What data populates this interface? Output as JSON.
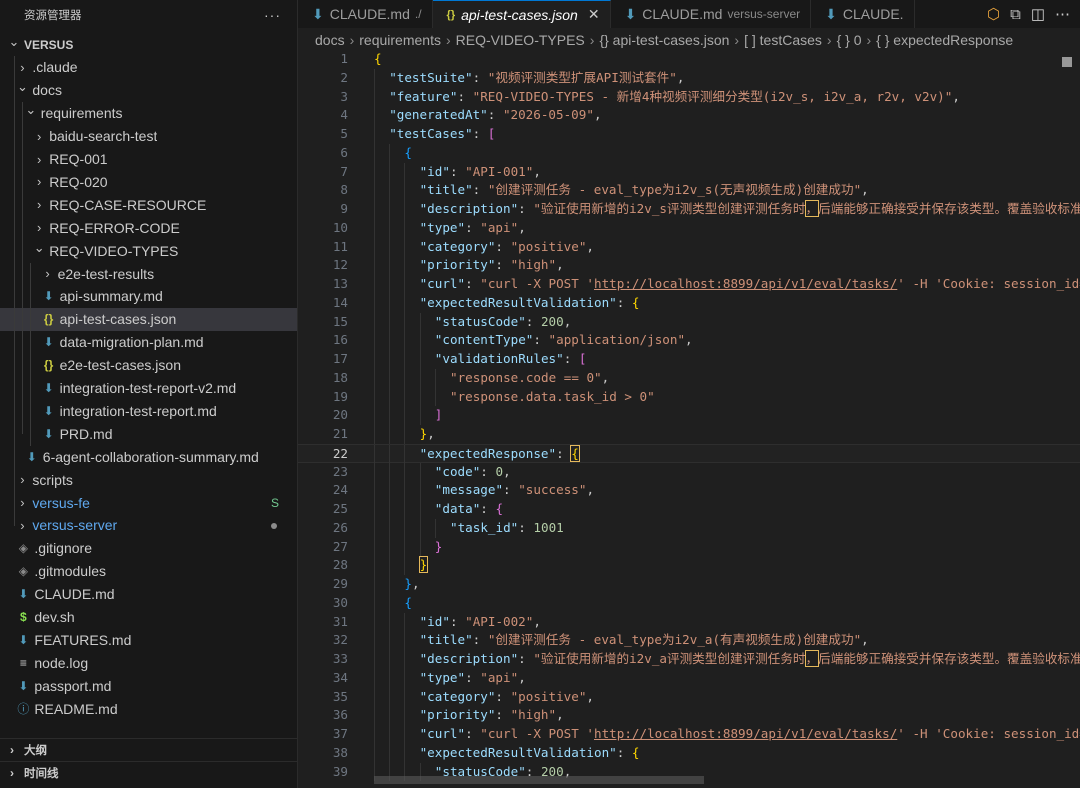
{
  "sidebar": {
    "title": "资源管理器",
    "more": "···",
    "tree": [
      {
        "label": "VERSUS",
        "depth": 0,
        "type": "root",
        "open": true
      },
      {
        "label": ".claude",
        "depth": 1,
        "type": "folder",
        "open": false
      },
      {
        "label": "docs",
        "depth": 1,
        "type": "folder",
        "open": true
      },
      {
        "label": "requirements",
        "depth": 2,
        "type": "folder",
        "open": true
      },
      {
        "label": "baidu-search-test",
        "depth": 3,
        "type": "folder",
        "open": false
      },
      {
        "label": "REQ-001",
        "depth": 3,
        "type": "folder",
        "open": false
      },
      {
        "label": "REQ-020",
        "depth": 3,
        "type": "folder",
        "open": false
      },
      {
        "label": "REQ-CASE-RESOURCE",
        "depth": 3,
        "type": "folder",
        "open": false
      },
      {
        "label": "REQ-ERROR-CODE",
        "depth": 3,
        "type": "folder",
        "open": false
      },
      {
        "label": "REQ-VIDEO-TYPES",
        "depth": 3,
        "type": "folder",
        "open": true
      },
      {
        "label": "e2e-test-results",
        "depth": 4,
        "type": "folder",
        "open": false
      },
      {
        "label": "api-summary.md",
        "depth": 4,
        "type": "md"
      },
      {
        "label": "api-test-cases.json",
        "depth": 4,
        "type": "json",
        "selected": true
      },
      {
        "label": "data-migration-plan.md",
        "depth": 4,
        "type": "md"
      },
      {
        "label": "e2e-test-cases.json",
        "depth": 4,
        "type": "json"
      },
      {
        "label": "integration-test-report-v2.md",
        "depth": 4,
        "type": "md"
      },
      {
        "label": "integration-test-report.md",
        "depth": 4,
        "type": "md"
      },
      {
        "label": "PRD.md",
        "depth": 4,
        "type": "md"
      },
      {
        "label": "6-agent-collaboration-summary.md",
        "depth": 2,
        "type": "md"
      },
      {
        "label": "scripts",
        "depth": 1,
        "type": "folder",
        "open": false
      },
      {
        "label": "versus-fe",
        "depth": 1,
        "type": "folder",
        "open": false,
        "color": "#5fa8ee",
        "badge": "S"
      },
      {
        "label": "versus-server",
        "depth": 1,
        "type": "folder",
        "open": false,
        "color": "#5fa8ee",
        "dot": true
      },
      {
        "label": ".gitignore",
        "depth": 1,
        "type": "git"
      },
      {
        "label": ".gitmodules",
        "depth": 1,
        "type": "git"
      },
      {
        "label": "CLAUDE.md",
        "depth": 1,
        "type": "md"
      },
      {
        "label": "dev.sh",
        "depth": 1,
        "type": "sh"
      },
      {
        "label": "FEATURES.md",
        "depth": 1,
        "type": "md"
      },
      {
        "label": "node.log",
        "depth": 1,
        "type": "log"
      },
      {
        "label": "passport.md",
        "depth": 1,
        "type": "md"
      },
      {
        "label": "README.md",
        "depth": 1,
        "type": "info"
      }
    ],
    "sections": [
      "大纲",
      "时间线"
    ]
  },
  "tabs": [
    {
      "label": "CLAUDE.md",
      "desc": "./",
      "icon": "md",
      "active": false
    },
    {
      "label": "api-test-cases.json",
      "desc": "",
      "icon": "json",
      "active": true,
      "close": "✕"
    },
    {
      "label": "CLAUDE.md",
      "desc": "versus-server",
      "icon": "md",
      "active": false
    },
    {
      "label": "CLAUDE.",
      "desc": "",
      "icon": "md",
      "active": false
    }
  ],
  "breadcrumb": [
    "docs",
    "requirements",
    "REQ-VIDEO-TYPES",
    "{} api-test-cases.json",
    "[ ] testCases",
    "{ } 0",
    "{ } expectedResponse"
  ],
  "breadcrumb_sep": "›",
  "editor": {
    "current_line": 22,
    "lines": [
      {
        "n": "1",
        "i": 0,
        "t": [
          [
            "b1",
            "{"
          ]
        ]
      },
      {
        "n": "2",
        "i": 1,
        "t": [
          [
            "k",
            "\"testSuite\""
          ],
          [
            "p",
            ": "
          ],
          [
            "s",
            "\"视频评测类型扩展API测试套件\""
          ],
          [
            "p",
            ","
          ]
        ]
      },
      {
        "n": "3",
        "i": 1,
        "t": [
          [
            "k",
            "\"feature\""
          ],
          [
            "p",
            ": "
          ],
          [
            "s",
            "\"REQ-VIDEO-TYPES - 新增4种视频评测细分类型(i2v_s, i2v_a, r2v, v2v)\""
          ],
          [
            "p",
            ","
          ]
        ]
      },
      {
        "n": "4",
        "i": 1,
        "t": [
          [
            "k",
            "\"generatedAt\""
          ],
          [
            "p",
            ": "
          ],
          [
            "s",
            "\"2026-05-09\""
          ],
          [
            "p",
            ","
          ]
        ]
      },
      {
        "n": "5",
        "i": 1,
        "t": [
          [
            "k",
            "\"testCases\""
          ],
          [
            "p",
            ": "
          ],
          [
            "b2",
            "["
          ]
        ]
      },
      {
        "n": "6",
        "i": 2,
        "t": [
          [
            "b3",
            "{"
          ]
        ]
      },
      {
        "n": "7",
        "i": 3,
        "t": [
          [
            "k",
            "\"id\""
          ],
          [
            "p",
            ": "
          ],
          [
            "s",
            "\"API-001\""
          ],
          [
            "p",
            ","
          ]
        ]
      },
      {
        "n": "8",
        "i": 3,
        "t": [
          [
            "k",
            "\"title\""
          ],
          [
            "p",
            ": "
          ],
          [
            "s",
            "\"创建评测任务 - eval_type为i2v_s(无声视频生成)创建成功\""
          ],
          [
            "p",
            ","
          ]
        ]
      },
      {
        "n": "9",
        "i": 3,
        "t": [
          [
            "k",
            "\"description\""
          ],
          [
            "p",
            ": "
          ],
          [
            "s",
            "\"验证使用新增的i2v_s评测类型创建评测任务时"
          ],
          [
            "smh",
            "，"
          ],
          [
            "s",
            "后端能够正确接受并保存该类型。覆盖验收标准"
          ]
        ]
      },
      {
        "n": "10",
        "i": 3,
        "t": [
          [
            "k",
            "\"type\""
          ],
          [
            "p",
            ": "
          ],
          [
            "s",
            "\"api\""
          ],
          [
            "p",
            ","
          ]
        ]
      },
      {
        "n": "11",
        "i": 3,
        "t": [
          [
            "k",
            "\"category\""
          ],
          [
            "p",
            ": "
          ],
          [
            "s",
            "\"positive\""
          ],
          [
            "p",
            ","
          ]
        ]
      },
      {
        "n": "12",
        "i": 3,
        "t": [
          [
            "k",
            "\"priority\""
          ],
          [
            "p",
            ": "
          ],
          [
            "s",
            "\"high\""
          ],
          [
            "p",
            ","
          ]
        ]
      },
      {
        "n": "13",
        "i": 3,
        "t": [
          [
            "k",
            "\"curl\""
          ],
          [
            "p",
            ": "
          ],
          [
            "s",
            "\"curl -X POST '"
          ],
          [
            "su",
            "http://localhost:8899/api/v1/eval/tasks/"
          ],
          [
            "s",
            "' -H 'Cookie: session_id="
          ]
        ]
      },
      {
        "n": "14",
        "i": 3,
        "t": [
          [
            "k",
            "\"expectedResultValidation\""
          ],
          [
            "p",
            ": "
          ],
          [
            "b1",
            "{"
          ]
        ]
      },
      {
        "n": "15",
        "i": 4,
        "t": [
          [
            "k",
            "\"statusCode\""
          ],
          [
            "p",
            ": "
          ],
          [
            "n",
            "200"
          ],
          [
            "p",
            ","
          ]
        ]
      },
      {
        "n": "16",
        "i": 4,
        "t": [
          [
            "k",
            "\"contentType\""
          ],
          [
            "p",
            ": "
          ],
          [
            "s",
            "\"application/json\""
          ],
          [
            "p",
            ","
          ]
        ]
      },
      {
        "n": "17",
        "i": 4,
        "t": [
          [
            "k",
            "\"validationRules\""
          ],
          [
            "p",
            ": "
          ],
          [
            "b2",
            "["
          ]
        ]
      },
      {
        "n": "18",
        "i": 5,
        "t": [
          [
            "s",
            "\"response.code == 0\""
          ],
          [
            "p",
            ","
          ]
        ]
      },
      {
        "n": "19",
        "i": 5,
        "t": [
          [
            "s",
            "\"response.data.task_id > 0\""
          ]
        ]
      },
      {
        "n": "20",
        "i": 4,
        "t": [
          [
            "b2",
            "]"
          ]
        ]
      },
      {
        "n": "21",
        "i": 3,
        "t": [
          [
            "b1",
            "}"
          ],
          [
            "p",
            ","
          ]
        ]
      },
      {
        "n": "22",
        "i": 3,
        "t": [
          [
            "k",
            "\"expectedResponse\""
          ],
          [
            "p",
            ": "
          ],
          [
            "b1mh",
            "{"
          ]
        ]
      },
      {
        "n": "23",
        "i": 4,
        "t": [
          [
            "k",
            "\"code\""
          ],
          [
            "p",
            ": "
          ],
          [
            "n",
            "0"
          ],
          [
            "p",
            ","
          ]
        ]
      },
      {
        "n": "24",
        "i": 4,
        "t": [
          [
            "k",
            "\"message\""
          ],
          [
            "p",
            ": "
          ],
          [
            "s",
            "\"success\""
          ],
          [
            "p",
            ","
          ]
        ]
      },
      {
        "n": "25",
        "i": 4,
        "t": [
          [
            "k",
            "\"data\""
          ],
          [
            "p",
            ": "
          ],
          [
            "b2",
            "{"
          ]
        ]
      },
      {
        "n": "26",
        "i": 5,
        "t": [
          [
            "k",
            "\"task_id\""
          ],
          [
            "p",
            ": "
          ],
          [
            "n",
            "1001"
          ]
        ]
      },
      {
        "n": "27",
        "i": 4,
        "t": [
          [
            "b2",
            "}"
          ]
        ]
      },
      {
        "n": "28",
        "i": 3,
        "t": [
          [
            "b1mh",
            "}"
          ]
        ]
      },
      {
        "n": "29",
        "i": 2,
        "t": [
          [
            "b3",
            "}"
          ],
          [
            "p",
            ","
          ]
        ]
      },
      {
        "n": "30",
        "i": 2,
        "t": [
          [
            "b3",
            "{"
          ]
        ]
      },
      {
        "n": "31",
        "i": 3,
        "t": [
          [
            "k",
            "\"id\""
          ],
          [
            "p",
            ": "
          ],
          [
            "s",
            "\"API-002\""
          ],
          [
            "p",
            ","
          ]
        ]
      },
      {
        "n": "32",
        "i": 3,
        "t": [
          [
            "k",
            "\"title\""
          ],
          [
            "p",
            ": "
          ],
          [
            "s",
            "\"创建评测任务 - eval_type为i2v_a(有声视频生成)创建成功\""
          ],
          [
            "p",
            ","
          ]
        ]
      },
      {
        "n": "33",
        "i": 3,
        "t": [
          [
            "k",
            "\"description\""
          ],
          [
            "p",
            ": "
          ],
          [
            "s",
            "\"验证使用新增的i2v_a评测类型创建评测任务时"
          ],
          [
            "smh",
            "，"
          ],
          [
            "s",
            "后端能够正确接受并保存该类型。覆盖验收标准"
          ]
        ]
      },
      {
        "n": "34",
        "i": 3,
        "t": [
          [
            "k",
            "\"type\""
          ],
          [
            "p",
            ": "
          ],
          [
            "s",
            "\"api\""
          ],
          [
            "p",
            ","
          ]
        ]
      },
      {
        "n": "35",
        "i": 3,
        "t": [
          [
            "k",
            "\"category\""
          ],
          [
            "p",
            ": "
          ],
          [
            "s",
            "\"positive\""
          ],
          [
            "p",
            ","
          ]
        ]
      },
      {
        "n": "36",
        "i": 3,
        "t": [
          [
            "k",
            "\"priority\""
          ],
          [
            "p",
            ": "
          ],
          [
            "s",
            "\"high\""
          ],
          [
            "p",
            ","
          ]
        ]
      },
      {
        "n": "37",
        "i": 3,
        "t": [
          [
            "k",
            "\"curl\""
          ],
          [
            "p",
            ": "
          ],
          [
            "s",
            "\"curl -X POST '"
          ],
          [
            "su",
            "http://localhost:8899/api/v1/eval/tasks/"
          ],
          [
            "s",
            "' -H 'Cookie: session_id="
          ]
        ]
      },
      {
        "n": "38",
        "i": 3,
        "t": [
          [
            "k",
            "\"expectedResultValidation\""
          ],
          [
            "p",
            ": "
          ],
          [
            "b1",
            "{"
          ]
        ]
      },
      {
        "n": "39",
        "i": 4,
        "t": [
          [
            "k",
            "\"statusCode\""
          ],
          [
            "p",
            ": "
          ],
          [
            "n",
            "200"
          ],
          [
            "p",
            ","
          ]
        ]
      }
    ]
  }
}
